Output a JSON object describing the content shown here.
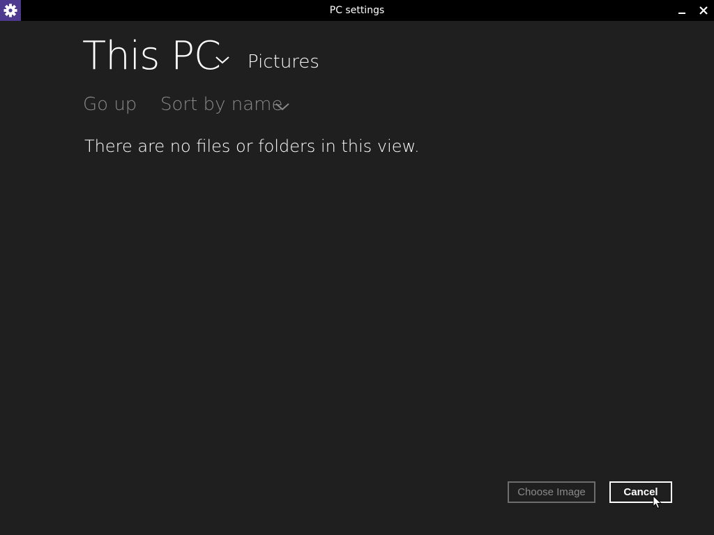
{
  "window": {
    "title": "PC settings",
    "app_icon": "gear-icon",
    "controls": [
      "minimize-icon",
      "close-icon"
    ]
  },
  "picker": {
    "location_title": "This PC",
    "location_dropdown_icon": "chevron-down-icon",
    "current_folder": "Pictures",
    "go_up_label": "Go up",
    "sort_label": "Sort by name",
    "sort_dropdown_icon": "chevron-down-icon",
    "empty_message": "There are no files or folders in this view."
  },
  "footer": {
    "choose_label": "Choose Image",
    "choose_enabled": false,
    "cancel_label": "Cancel"
  },
  "colors": {
    "background": "#1f1f1f",
    "titlebar": "#000000",
    "app_icon_bg": "#4e3a8e",
    "text_primary": "#ffffff",
    "text_secondary": "#8a8a8a"
  }
}
